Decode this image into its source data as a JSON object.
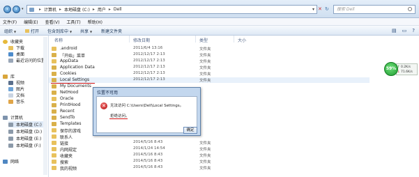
{
  "address": {
    "crumbs": [
      "计算机",
      "本地磁盘 (C:)",
      "用户",
      "Dell"
    ],
    "search_placeholder": "搜索 Dell"
  },
  "menu": [
    "文件(F)",
    "编辑(E)",
    "查看(V)",
    "工具(T)",
    "帮助(H)"
  ],
  "toolbar": {
    "organize": "组织",
    "open": "打开",
    "include_library": "包含到库中",
    "share": "共享",
    "new_folder": "新建文件夹"
  },
  "nav": {
    "favorites": "收藏夹",
    "downloads": "下载",
    "desktop": "桌面",
    "recent": "最近访问的位置",
    "libraries": "库",
    "videos": "视频",
    "pictures": "图片",
    "documents": "文档",
    "music": "音乐",
    "computer": "计算机",
    "drive_c": "本地磁盘 (C:)",
    "drive_d": "本地磁盘 (D:)",
    "drive_e": "本地磁盘 (E:)",
    "drive_f": "本地磁盘 (F:)",
    "network": "网络"
  },
  "columns": {
    "name": "名称",
    "date": "修改日期",
    "type": "类型",
    "size": "大小"
  },
  "files": [
    {
      "name": ".android",
      "date": "2011/6/4 13:16",
      "type": "文件夹"
    },
    {
      "name": "「开始」菜单",
      "date": "2012/12/17 2:13",
      "type": "文件夹"
    },
    {
      "name": "AppData",
      "date": "2012/12/17 2:13",
      "type": "文件夹"
    },
    {
      "name": "Application Data",
      "date": "2012/12/17 2:13",
      "type": "文件夹"
    },
    {
      "name": "Cookies",
      "date": "2012/12/17 2:13",
      "type": "文件夹"
    },
    {
      "name": "Local Settings",
      "date": "2012/12/17 2:13",
      "type": "文件夹"
    },
    {
      "name": "My Documents",
      "date": "",
      "type": ""
    },
    {
      "name": "NetHood",
      "date": "",
      "type": ""
    },
    {
      "name": "Oracle",
      "date": "",
      "type": ""
    },
    {
      "name": "PrintHood",
      "date": "",
      "type": ""
    },
    {
      "name": "Recent",
      "date": "",
      "type": ""
    },
    {
      "name": "SendTo",
      "date": "",
      "type": ""
    },
    {
      "name": "Templates",
      "date": "",
      "type": ""
    },
    {
      "name": "保存的游戏",
      "date": "",
      "type": ""
    },
    {
      "name": "联系人",
      "date": "",
      "type": ""
    },
    {
      "name": "链接",
      "date": "2014/5/16 8:43",
      "type": "文件夹"
    },
    {
      "name": "内网规定",
      "date": "2014/1/24 14:54",
      "type": "文件夹"
    },
    {
      "name": "收藏夹",
      "date": "2014/5/16 8:43",
      "type": "文件夹"
    },
    {
      "name": "搜索",
      "date": "2014/5/16 8:43",
      "type": "文件夹"
    },
    {
      "name": "我的视频",
      "date": "2014/5/16 8:43",
      "type": "文件夹"
    }
  ],
  "gadget": {
    "percent": "59%",
    "upload": "0.2K/s",
    "download": "71.6K/s"
  },
  "dialog": {
    "title": "位置不可用",
    "message": "无法访问 C:\\Users\\Dell\\Local Settings。",
    "detail": "拒绝访问。",
    "ok": "确定"
  },
  "colors": {
    "folder": "#e8c15c",
    "shortcut_folder": "#d9b04a",
    "annotation_red": "#d21414",
    "error_red": "#c21a1a",
    "gadget_green": "#22a534"
  },
  "icons": {
    "file_rows": "folder-icon",
    "dialog": "error-icon"
  }
}
